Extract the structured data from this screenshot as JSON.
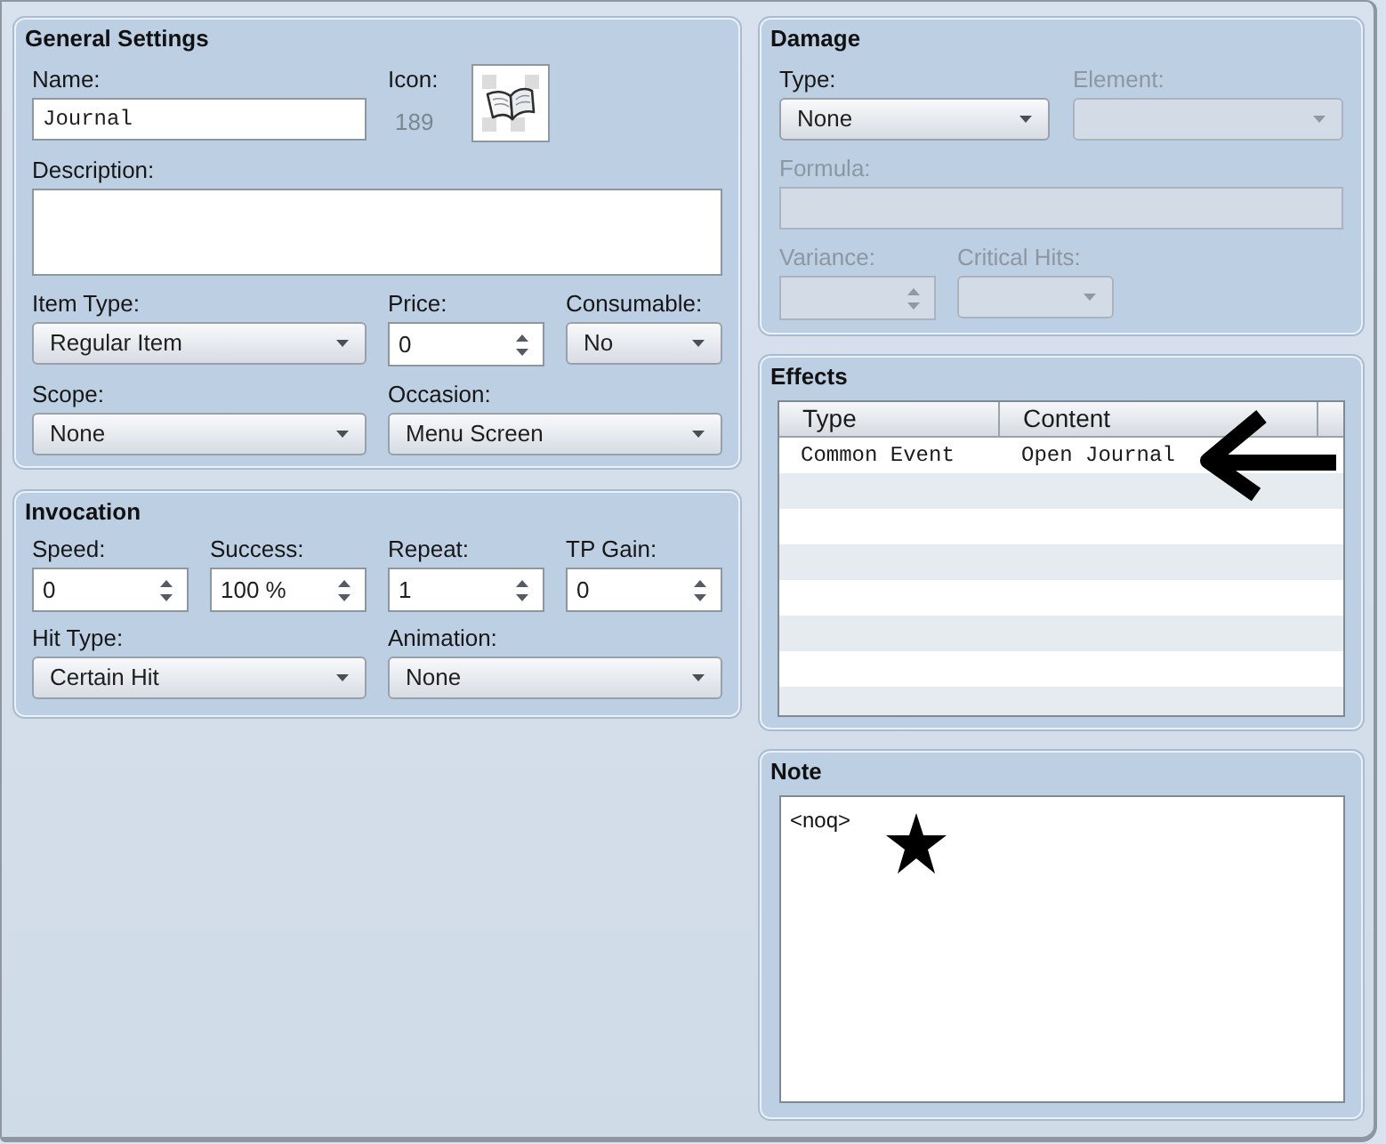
{
  "general_settings": {
    "title": "General Settings",
    "name": {
      "label": "Name:",
      "value": "Journal"
    },
    "icon": {
      "label": "Icon:",
      "index": "189"
    },
    "description": {
      "label": "Description:"
    },
    "item_type": {
      "label": "Item Type:",
      "value": "Regular Item"
    },
    "price": {
      "label": "Price:",
      "value": "0"
    },
    "consumable": {
      "label": "Consumable:",
      "value": "No"
    },
    "scope": {
      "label": "Scope:",
      "value": "None"
    },
    "occasion": {
      "label": "Occasion:",
      "value": "Menu Screen"
    }
  },
  "invocation": {
    "title": "Invocation",
    "speed": {
      "label": "Speed:",
      "value": "0"
    },
    "success": {
      "label": "Success:",
      "value": "100 %"
    },
    "repeat": {
      "label": "Repeat:",
      "value": "1"
    },
    "tp_gain": {
      "label": "TP Gain:",
      "value": "0"
    },
    "hit_type": {
      "label": "Hit Type:",
      "value": "Certain Hit"
    },
    "animation": {
      "label": "Animation:",
      "value": "None"
    }
  },
  "damage": {
    "title": "Damage",
    "type": {
      "label": "Type:",
      "value": "None",
      "disabled": false
    },
    "element": {
      "label": "Element:",
      "disabled": true
    },
    "formula": {
      "label": "Formula:",
      "disabled": true
    },
    "variance": {
      "label": "Variance:",
      "disabled": true
    },
    "critical_hits": {
      "label": "Critical Hits:",
      "disabled": true
    }
  },
  "effects": {
    "title": "Effects",
    "columns": [
      "Type",
      "Content"
    ],
    "rows": [
      [
        "Common Event",
        "Open Journal"
      ]
    ]
  },
  "note": {
    "title": "Note",
    "value": "<noq>"
  }
}
